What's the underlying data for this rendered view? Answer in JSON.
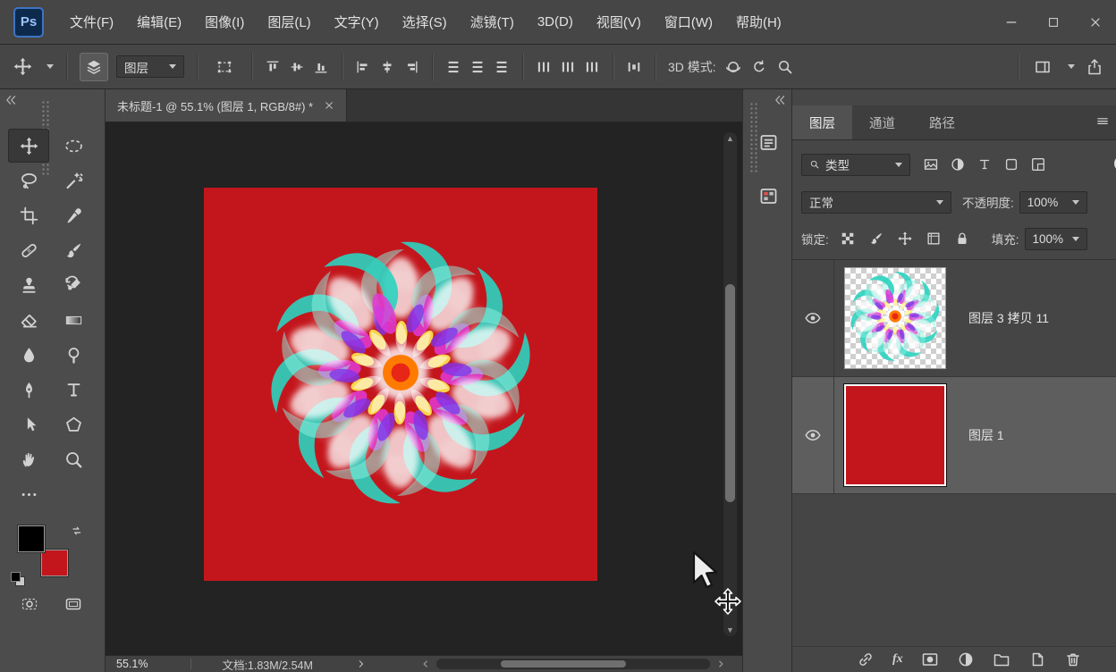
{
  "app": {
    "logo_text": "Ps"
  },
  "menubar": {
    "items": [
      "文件(F)",
      "编辑(E)",
      "图像(I)",
      "图层(L)",
      "文字(Y)",
      "选择(S)",
      "滤镜(T)",
      "3D(D)",
      "视图(V)",
      "窗口(W)",
      "帮助(H)"
    ]
  },
  "options_bar": {
    "layer_select_label": "图层",
    "mode_label": "3D 模式:"
  },
  "tools": [
    {
      "name": "move-tool",
      "selected": true
    },
    {
      "name": "marquee-tool"
    },
    {
      "name": "lasso-tool"
    },
    {
      "name": "magic-wand-tool"
    },
    {
      "name": "crop-tool"
    },
    {
      "name": "eyedropper-tool"
    },
    {
      "name": "healing-brush-tool"
    },
    {
      "name": "brush-tool"
    },
    {
      "name": "clone-stamp-tool"
    },
    {
      "name": "history-brush-tool"
    },
    {
      "name": "eraser-tool"
    },
    {
      "name": "gradient-tool"
    },
    {
      "name": "blur-tool"
    },
    {
      "name": "dodge-tool"
    },
    {
      "name": "pen-tool"
    },
    {
      "name": "type-tool"
    },
    {
      "name": "path-selection-tool"
    },
    {
      "name": "shape-tool"
    },
    {
      "name": "hand-tool"
    },
    {
      "name": "zoom-tool"
    },
    {
      "name": "more-tools"
    }
  ],
  "swatches": {
    "foreground": "#000000",
    "background": "#c3161c"
  },
  "document": {
    "tab_title": "未标题-1 @ 55.1% (图层 1, RGB/8#) *",
    "zoom_level": "55.1%",
    "doc_info": "文档:1.83M/2.54M",
    "canvas_color": "#c3161c"
  },
  "panels": {
    "tabs": [
      {
        "label": "图层",
        "active": true
      },
      {
        "label": "通道",
        "active": false
      },
      {
        "label": "路径",
        "active": false
      }
    ]
  },
  "layers_panel": {
    "filter_label": "类型",
    "blend_mode": "正常",
    "opacity_label": "不透明度:",
    "opacity_value": "100%",
    "lock_label": "锁定:",
    "fill_label": "填充:",
    "fill_value": "100%",
    "fx_label": "fx",
    "layers": [
      {
        "name": "图层 3 拷贝 11",
        "visible": true,
        "selected": false,
        "thumbnail": "flower-on-transparent"
      },
      {
        "name": "图层 1",
        "visible": true,
        "selected": true,
        "thumbnail": "solid-red"
      }
    ]
  },
  "flower": {
    "petals": 10,
    "teal": "#2bd3c0",
    "teal_light": "#8df2e2",
    "white": "#ffffff",
    "magenta": "#e23ad8",
    "purple": "#8233e8",
    "yellow": "#ffe94f",
    "orange": "#ff7b00",
    "core": "#e82617"
  },
  "colors": {
    "canvas_red": "#c3161c",
    "ui": "#464646",
    "ui_dark": "#3a3a3a",
    "selected_row": "#5e5e5e"
  }
}
